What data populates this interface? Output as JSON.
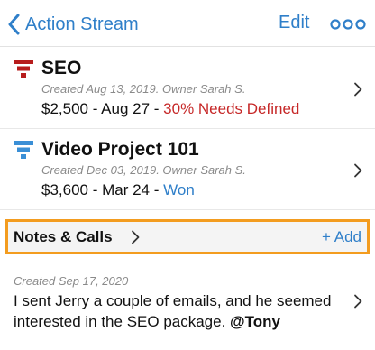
{
  "nav": {
    "back_label": "Action Stream",
    "back_icon": "chevron-left-icon",
    "edit_label": "Edit",
    "more_icon": "more-circles-icon",
    "accent_color": "#2f7fc9"
  },
  "deals": [
    {
      "title": "SEO",
      "icon": "funnel-icon",
      "icon_color": "#b71c1c",
      "meta": "Created Aug 13, 2019. Owner Sarah S.",
      "amount_date": "$2,500 - Aug 27 - ",
      "status": "30% Needs Defined",
      "status_color": "#c62828"
    },
    {
      "title": "Video Project 101",
      "icon": "funnel-icon",
      "icon_color": "#3a8fd6",
      "meta": "Created Dec 03, 2019. Owner Sarah S.",
      "amount_date": "$3,600 - Mar 24 - ",
      "status": "Won",
      "status_color": "#2f7fc9"
    }
  ],
  "notes_section": {
    "title": "Notes & Calls",
    "add_label": "+ Add",
    "highlight_color": "#f39c1f"
  },
  "notes": [
    {
      "meta": "Created Sep 17, 2020",
      "text": "I sent Jerry a couple of emails, and he seemed interested in the SEO package. ",
      "mention": "@Tony"
    }
  ]
}
